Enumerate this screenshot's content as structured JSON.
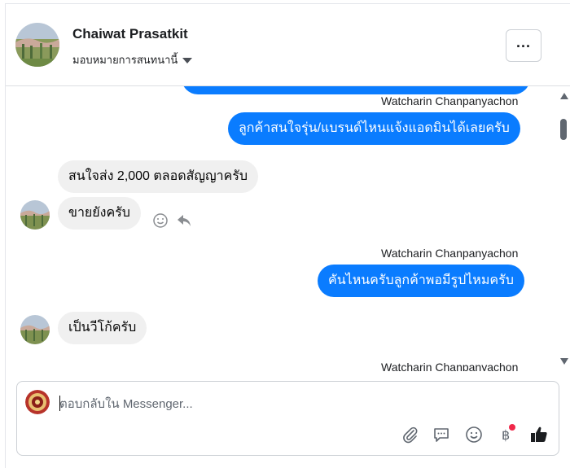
{
  "header": {
    "contact_name": "Chaiwat Prasatkit",
    "assign_label": "มอบหมายการสนทนานี้",
    "more_icon": "ellipsis-icon"
  },
  "messages": [
    {
      "id": "m0",
      "direction": "outgoing",
      "text": ""
    },
    {
      "id": "m1",
      "direction": "outgoing",
      "sender": "Watcharin Chanpanyachon",
      "text": "ลูกค้าสนใจรุ่น/แบรนด์ไหนแจ้งแอดมินได้เลยครับ"
    },
    {
      "id": "m2",
      "direction": "incoming",
      "text": "สนใจส่ง 2,000 ตลอดสัญญาครับ"
    },
    {
      "id": "m3",
      "direction": "incoming",
      "text": "ขายยังครับ"
    },
    {
      "id": "m4",
      "direction": "outgoing",
      "sender": "Watcharin Chanpanyachon",
      "text": "คันไหนครับลูกค้าพอมีรูปไหมครับ"
    },
    {
      "id": "m5",
      "direction": "incoming",
      "text": "เป็นวีโก้ครับ"
    },
    {
      "id": "m6",
      "direction": "outgoing",
      "sender": "Watcharin Chanpanyachon",
      "text": ""
    }
  ],
  "message_actions": {
    "react_icon": "smiley-icon",
    "reply_icon": "reply-arrow-icon"
  },
  "composer": {
    "placeholder": "ตอบกลับใน Messenger...",
    "value": "",
    "tools": [
      "paperclip-icon",
      "comment-icon",
      "smiley-icon",
      "baht-icon",
      "thumbs-up-icon"
    ]
  },
  "colors": {
    "outgoing_bubble": "#0a7cff",
    "incoming_bubble": "#f0f0f0",
    "like": "#1c1e21",
    "notification_dot": "#f02849"
  }
}
